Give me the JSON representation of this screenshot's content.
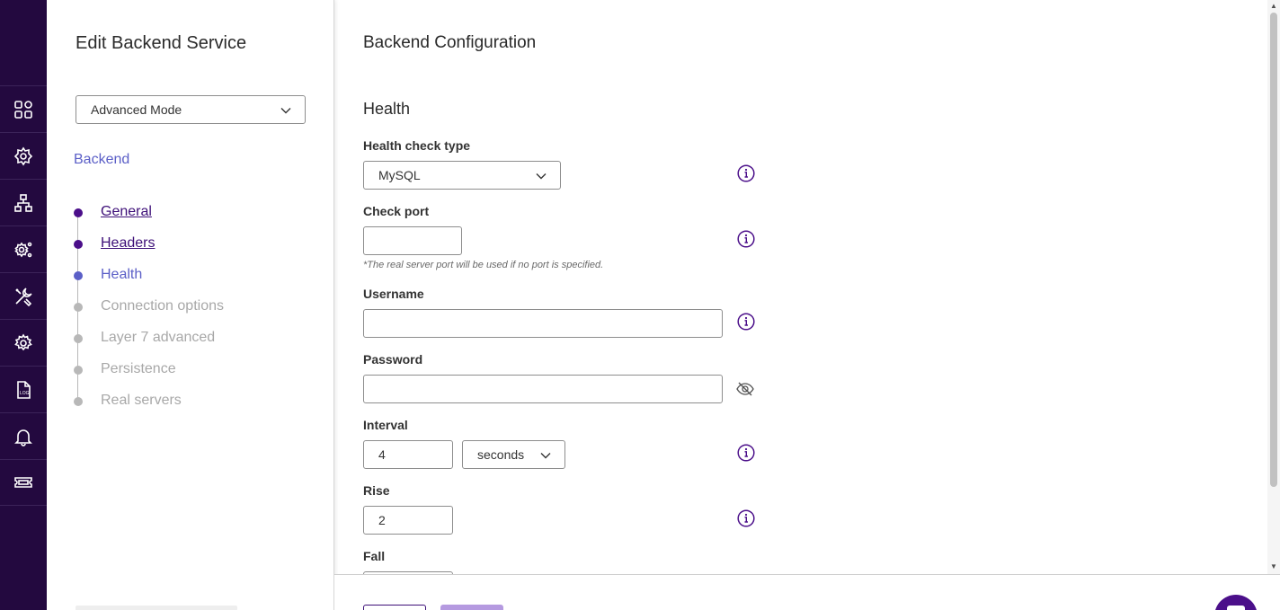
{
  "rail": {
    "items": [
      {
        "icon": "dashboard-icon"
      },
      {
        "icon": "virtual-services-icon"
      },
      {
        "icon": "network-icon"
      },
      {
        "icon": "service-settings-icon"
      },
      {
        "icon": "tools-icon"
      },
      {
        "icon": "settings-gear-icon"
      },
      {
        "icon": "log-file-icon",
        "text": "LOG"
      },
      {
        "icon": "notifications-bell-icon"
      },
      {
        "icon": "ticket-icon"
      }
    ]
  },
  "sidebar": {
    "title": "Edit Backend Service",
    "mode_select": {
      "value": "Advanced Mode"
    },
    "section_link": "Backend",
    "steps": [
      {
        "label": "General",
        "state": "done"
      },
      {
        "label": "Headers",
        "state": "done"
      },
      {
        "label": "Health",
        "state": "current"
      },
      {
        "label": "Connection options",
        "state": "pending"
      },
      {
        "label": "Layer 7 advanced",
        "state": "pending"
      },
      {
        "label": "Persistence",
        "state": "pending"
      },
      {
        "label": "Real servers",
        "state": "pending"
      }
    ]
  },
  "main": {
    "title": "Backend Configuration",
    "group_title": "Health",
    "health_check_type": {
      "label": "Health check type",
      "value": "MySQL"
    },
    "check_port": {
      "label": "Check port",
      "value": "",
      "hint": "*The real server port will be used if no port is specified."
    },
    "username": {
      "label": "Username",
      "value": ""
    },
    "password": {
      "label": "Password",
      "value": ""
    },
    "interval": {
      "label": "Interval",
      "value": "4",
      "unit": "seconds"
    },
    "rise": {
      "label": "Rise",
      "value": "2"
    },
    "fall": {
      "label": "Fall"
    }
  },
  "colors": {
    "rail_bg": "#23093f",
    "accent": "#4b0f8a",
    "link": "#5b5fc7",
    "save_button": "#b59ae0"
  }
}
